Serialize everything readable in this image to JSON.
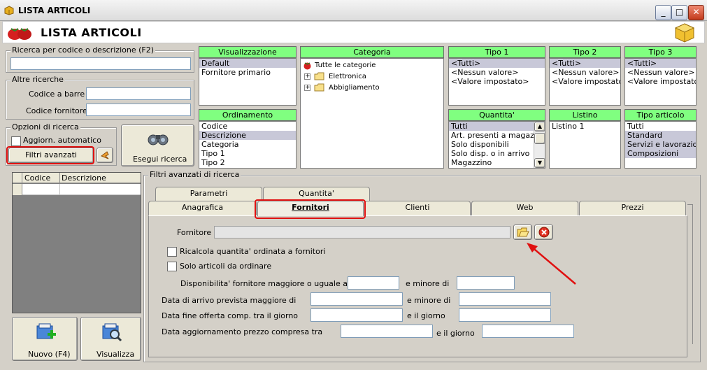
{
  "window": {
    "title": "LISTA ARTICOLI"
  },
  "header": {
    "title": "LISTA ARTICOLI"
  },
  "search": {
    "label": "Ricerca per codice o descrizione (F2)",
    "value": ""
  },
  "other": {
    "label": "Altre ricerche",
    "barcode_label": "Codice a barre :",
    "supplier_code_label": "Codice fornitore :"
  },
  "options": {
    "label": "Opzioni di ricerca",
    "auto_update": "Aggiorn. automatico",
    "advanced_filters": "Filtri avanzati",
    "run_search": "Esegui ricerca"
  },
  "visualizzazione": {
    "title": "Visualizzazione",
    "items": [
      "Default",
      "Fornitore primario"
    ]
  },
  "ordinamento": {
    "title": "Ordinamento",
    "items": [
      "Codice",
      "Descrizione",
      "Categoria",
      "Tipo 1",
      "Tipo 2"
    ]
  },
  "categoria": {
    "title": "Categoria",
    "root": "Tutte le categorie",
    "children": [
      "Elettronica",
      "Abbigliamento"
    ]
  },
  "tipo1": {
    "title": "Tipo 1",
    "items": [
      "<Tutti>",
      "<Nessun valore>",
      "<Valore impostato>"
    ]
  },
  "tipo2": {
    "title": "Tipo 2",
    "items": [
      "<Tutti>",
      "<Nessun valore>",
      "<Valore impostato>"
    ]
  },
  "tipo3": {
    "title": "Tipo 3",
    "items": [
      "<Tutti>",
      "<Nessun valore>",
      "<Valore impostato>"
    ]
  },
  "quantita": {
    "title": "Quantita'",
    "items": [
      "Tutti",
      "Art. presenti a magazzino",
      "Solo disponibili",
      "Solo disp. o in arrivo",
      "Magazzino"
    ]
  },
  "listino": {
    "title": "Listino",
    "items": [
      "Listino 1"
    ]
  },
  "tipo_articolo": {
    "title": "Tipo articolo",
    "items": [
      "Tutti",
      "Standard",
      "Servizi e lavorazioni",
      "Composizioni"
    ]
  },
  "grid": {
    "columns": [
      "Codice",
      "Descrizione"
    ]
  },
  "bottom_buttons": {
    "new": "Nuovo (F4)",
    "view": "Visualizza"
  },
  "advanced": {
    "title": "Filtri avanzati di ricerca",
    "tabs_back": [
      "Parametri",
      "Quantita'"
    ],
    "tabs_front": [
      "Anagrafica",
      "Fornitori",
      "Clienti",
      "Web",
      "Prezzi"
    ],
    "fornitore_label": "Fornitore :",
    "recalc_label": "Ricalcola quantita' ordinata a fornitori",
    "only_to_order_label": "Solo articoli da ordinare",
    "availability_label": "Disponibilita' fornitore maggiore o uguale a",
    "and_less_than": "e minore di",
    "arrival_label": "Data di arrivo prevista maggiore di",
    "and_less_than_2": "e minore di",
    "offer_end_label": "Data fine offerta comp. tra il giorno",
    "and_day": "e il giorno",
    "price_update_label": "Data aggiornamento prezzo compresa tra",
    "and_day_2": "e il giorno"
  },
  "colors": {
    "panel_header": "#80ff80",
    "highlight": "#e01010",
    "window_bg": "#d4d0c8"
  }
}
